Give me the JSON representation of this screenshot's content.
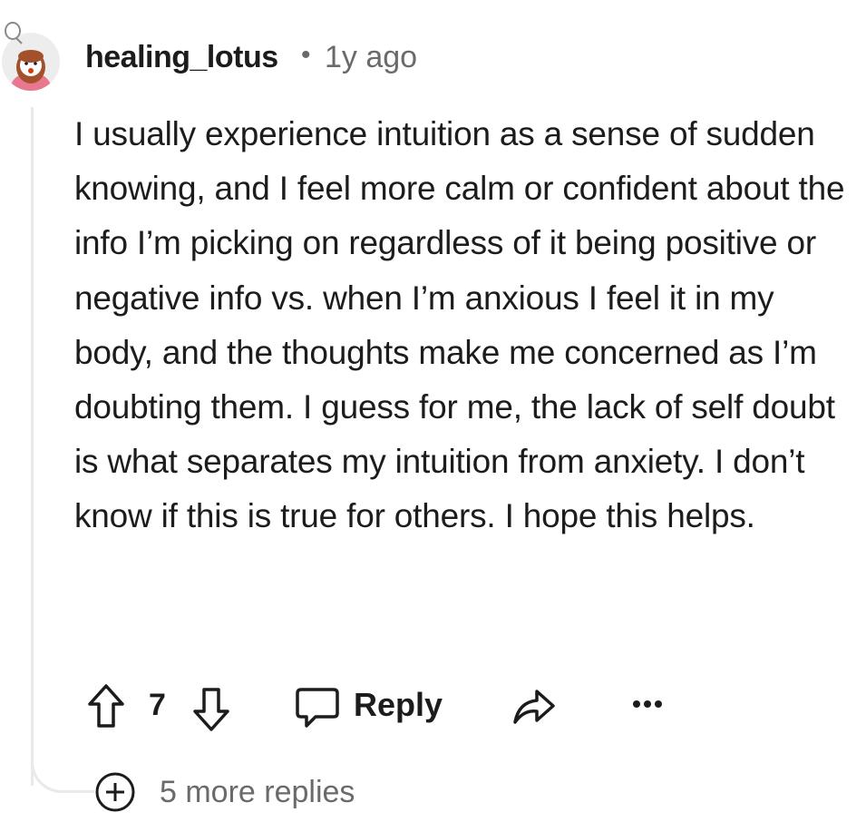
{
  "comment": {
    "username": "healing_lotus",
    "separator": "•",
    "timestamp": "1y ago",
    "body": "I usually experience intuition as a sense of sudden knowing, and I feel more calm or confident about the info I’m picking on regardless of it being positive or negative info vs. when I’m anxious I feel it in my body, and the thoughts make me concerned as I’m doubting them. I guess for me, the lack of self doubt is what separates my intuition from anxiety. I don’t know if this is true for others. I hope this helps.",
    "avatar_icon": "user-avatar",
    "colors": {
      "text": "#1c1c1c",
      "meta": "#6a6a6a",
      "thread_line": "#e9e9e9"
    }
  },
  "actions": {
    "upvote_icon": "arrow-up-icon",
    "vote_count": "7",
    "downvote_icon": "arrow-down-icon",
    "reply_icon": "speech-bubble-icon",
    "reply_label": "Reply",
    "share_icon": "share-arrow-icon",
    "more_icon": "ellipsis-icon"
  },
  "more_replies": {
    "icon": "plus-circle-icon",
    "label": "5 more replies"
  }
}
